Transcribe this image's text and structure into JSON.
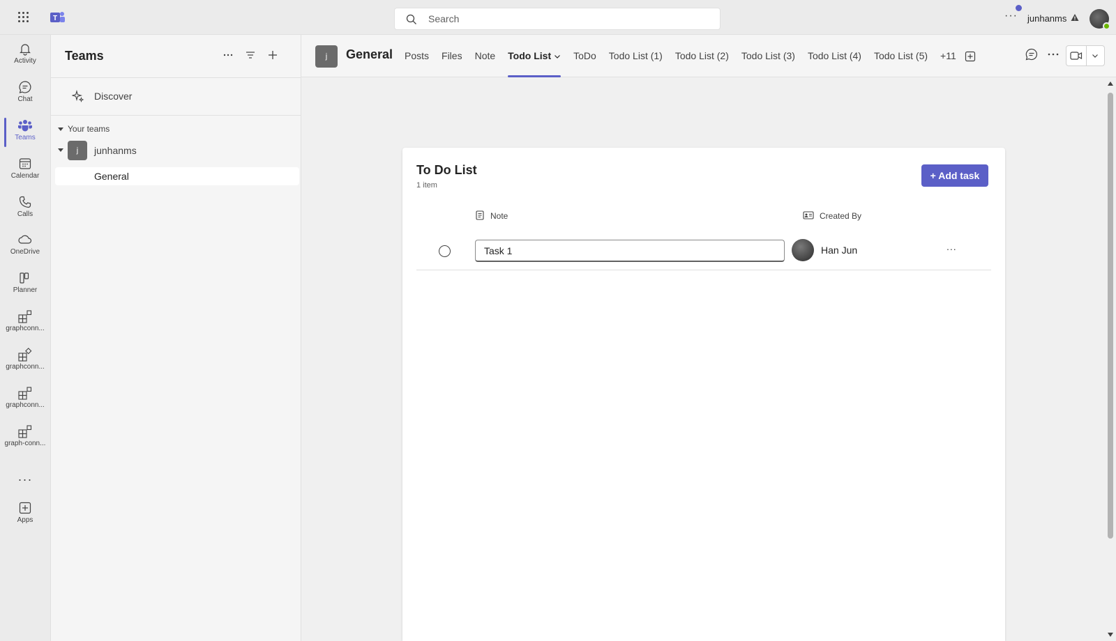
{
  "topbar": {
    "search_placeholder": "Search",
    "more": "···",
    "username": "junhanms"
  },
  "rail": {
    "items": [
      {
        "label": "Activity",
        "icon": "bell-icon"
      },
      {
        "label": "Chat",
        "icon": "chat-icon"
      },
      {
        "label": "Teams",
        "icon": "teams-icon",
        "active": true
      },
      {
        "label": "Calendar",
        "icon": "calendar-icon"
      },
      {
        "label": "Calls",
        "icon": "phone-icon"
      },
      {
        "label": "OneDrive",
        "icon": "cloud-icon"
      },
      {
        "label": "Planner",
        "icon": "planner-icon"
      },
      {
        "label": "graphconn...",
        "icon": "app-icon"
      },
      {
        "label": "graphconn...",
        "icon": "app-icon"
      },
      {
        "label": "graphconn...",
        "icon": "app-icon"
      },
      {
        "label": "graph-conn...",
        "icon": "app-icon"
      }
    ],
    "more": "···",
    "apps_label": "Apps"
  },
  "pane": {
    "title": "Teams",
    "discover": "Discover",
    "your_teams": "Your teams",
    "team_avatar": "j",
    "team_name": "junhanms",
    "channel": "General"
  },
  "channel": {
    "avatar": "j",
    "name": "General",
    "tabs": [
      "Posts",
      "Files",
      "Note",
      "Todo List",
      "ToDo",
      "Todo List (1)",
      "Todo List (2)",
      "Todo List (3)",
      "Todo List (4)",
      "Todo List (5)",
      "+11"
    ],
    "active_tab": "Todo List"
  },
  "todo": {
    "title": "To Do List",
    "count": "1 item",
    "add_button": "+ Add task",
    "col_note": "Note",
    "col_created_by": "Created By",
    "rows": [
      {
        "task": "Task 1",
        "created_by": "Han Jun",
        "more": "..."
      }
    ]
  },
  "colors": {
    "accent": "#5b5fc7",
    "background": "#ebebeb",
    "pane": "#f5f5f5"
  }
}
